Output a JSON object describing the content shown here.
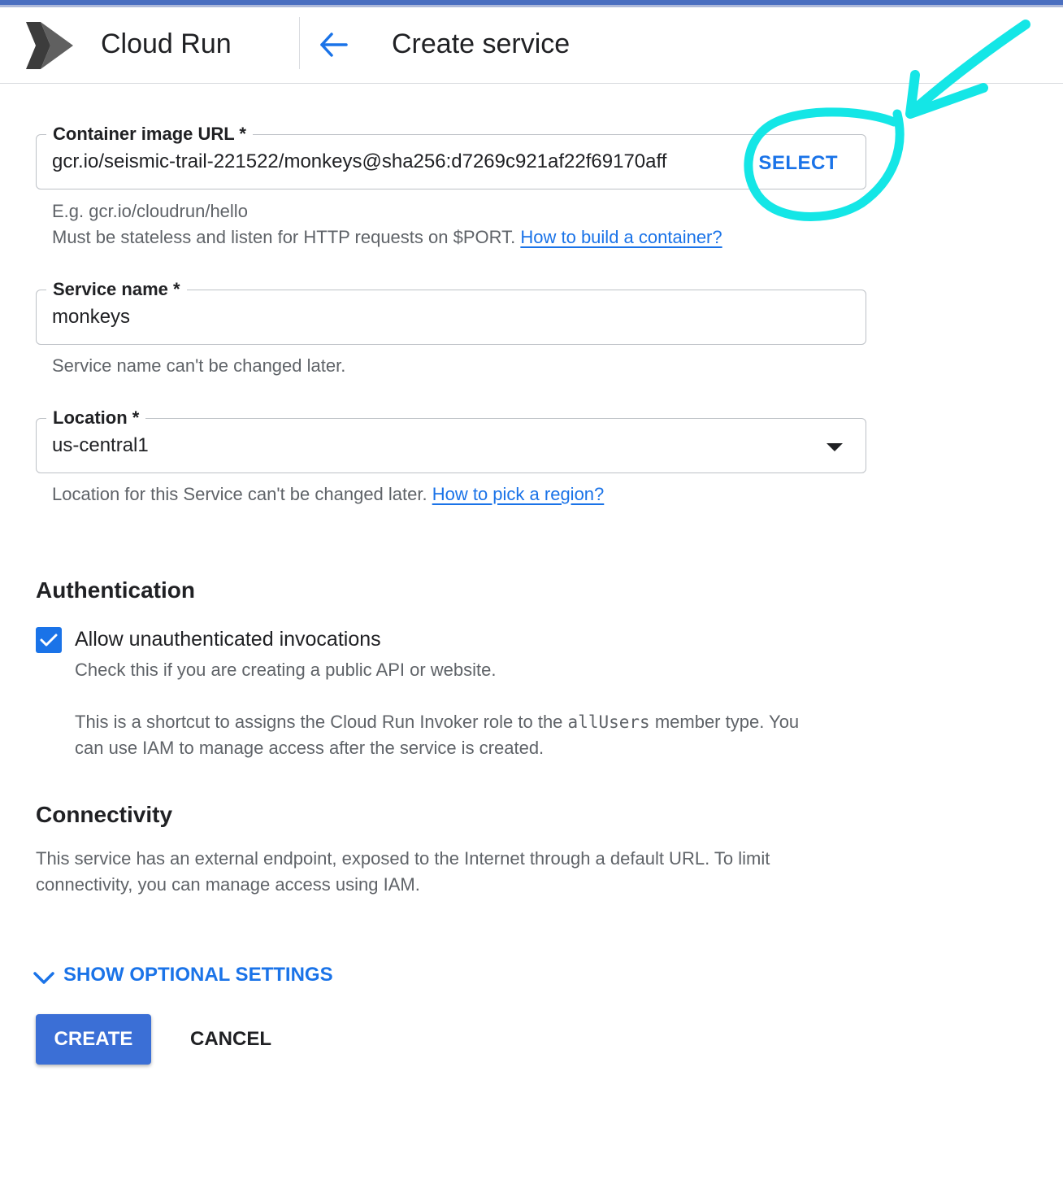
{
  "header": {
    "app_title": "Cloud Run",
    "page_title": "Create service"
  },
  "container_image": {
    "label": "Container image URL *",
    "value": "gcr.io/seismic-trail-221522/monkeys@sha256:d7269c921af22f69170aff",
    "select_label": "SELECT",
    "hint_example": "E.g. gcr.io/cloudrun/hello",
    "hint_text": "Must be stateless and listen for HTTP requests on $PORT.",
    "hint_link": "How to build a container?"
  },
  "service_name": {
    "label": "Service name *",
    "value": "monkeys",
    "hint": "Service name can't be changed later."
  },
  "location": {
    "label": "Location *",
    "value": "us-central1",
    "hint_text": "Location for this Service can't be changed later.",
    "hint_link": "How to pick a region?"
  },
  "authentication": {
    "title": "Authentication",
    "checkbox_label": "Allow unauthenticated invocations",
    "checked": true,
    "desc1": "Check this if you are creating a public API or website.",
    "desc2_pre": "This is a shortcut to assigns the Cloud Run Invoker role to the",
    "desc2_code": "allUsers",
    "desc2_post": "member type. You",
    "desc2_line2": "can use IAM to manage access after the service is created."
  },
  "connectivity": {
    "title": "Connectivity",
    "line1": "This service has an external endpoint, exposed to the Internet through a default URL. To limit",
    "line2": "connectivity, you can manage access using IAM."
  },
  "optional_settings_label": "SHOW OPTIONAL SETTINGS",
  "actions": {
    "create_label": "CREATE",
    "cancel_label": "CANCEL"
  },
  "colors": {
    "accent": "#1a73e8",
    "primary_button": "#3b6fd6",
    "annotation": "#14e6e6"
  },
  "icons": {
    "logo": "cloud-run-logo",
    "back": "arrow-left-icon",
    "dropdown": "caret-down-icon",
    "expand": "chevron-down-icon",
    "check": "check-icon"
  }
}
